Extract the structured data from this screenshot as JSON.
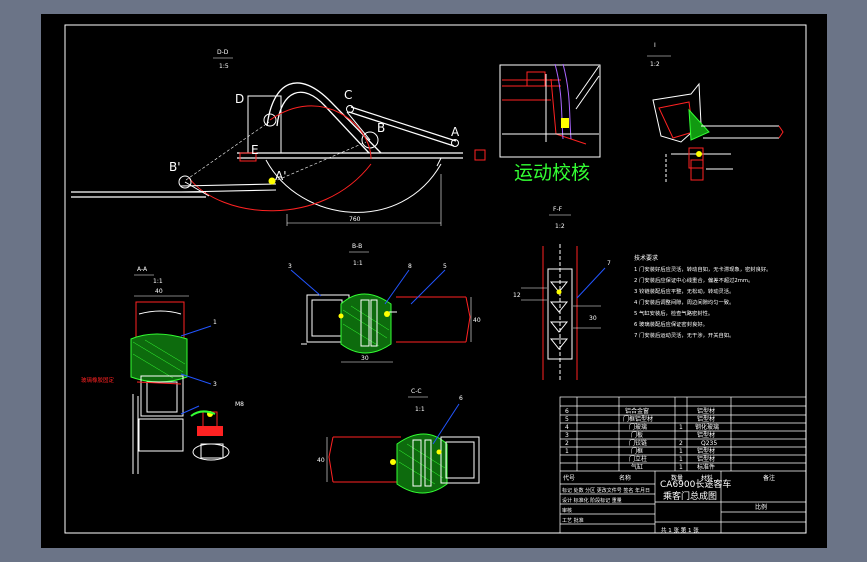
{
  "main_view": {
    "section_label": "D-D",
    "section_scale": "1:5",
    "point_labels": {
      "D": "D",
      "C": "C",
      "B": "B",
      "A": "A",
      "B1": "B'",
      "A1": "A'",
      "E": "E"
    },
    "dimension": "760",
    "motion_check_title": "运动校核"
  },
  "detail_I": {
    "label": "I",
    "scale": "1:2"
  },
  "section_BB": {
    "label": "B-B",
    "scale": "1:1",
    "callouts": [
      "3",
      "8",
      "5"
    ],
    "dim_width": "30",
    "dim_height": "40"
  },
  "section_AA": {
    "label": "A-A",
    "scale": "1:1",
    "dim_width": "40",
    "callouts": [
      "1",
      "3"
    ],
    "note_red": "玻璃橡胶固定",
    "dim_small": "M8"
  },
  "section_CC": {
    "label": "C-C",
    "scale": "1:1",
    "callouts": [
      "6"
    ],
    "dim_height": "40"
  },
  "section_FF": {
    "label": "F-F",
    "scale": "1:2",
    "callouts": [
      "7"
    ],
    "dim_a": "12",
    "dim_b": "30"
  },
  "tech_requirements": {
    "title": "技术要求",
    "items": [
      "1 门安装好后应灵活，转动自如，无卡滞现象，密封良好。",
      "2 门安装后应保证中心线重合，偏差不超过2mm。",
      "3 铰链装配后应平整，无松动，转动灵活。",
      "4 门安装后调整间隙，周边间隙均匀一致。",
      "5 气缸安装后，检查气路密封性。",
      "6 玻璃装配后应保证密封良好。",
      "7 门安装后运动灵活，无干涉，开关自如。"
    ]
  },
  "title_block": {
    "parts": [
      {
        "no": "6",
        "name": "铝合金窗",
        "qty": "",
        "mat": "铝型材",
        "note": ""
      },
      {
        "no": "5",
        "name": "门框铝型材",
        "qty": "",
        "mat": "铝型材",
        "note": ""
      },
      {
        "no": "4",
        "name": "门玻璃",
        "qty": "1",
        "mat": "钢化玻璃",
        "note": ""
      },
      {
        "no": "3",
        "name": "门板",
        "qty": "",
        "mat": "铝型材",
        "note": ""
      },
      {
        "no": "2",
        "name": "门铰链",
        "qty": "2",
        "mat": "Q235",
        "note": ""
      },
      {
        "no": "1",
        "name": "门框",
        "qty": "1",
        "mat": "铝型材",
        "note": ""
      },
      {
        "no": "",
        "name": "门立柱",
        "qty": "1",
        "mat": "铝型材",
        "note": ""
      },
      {
        "no": "",
        "name": "气缸",
        "qty": "1",
        "mat": "标准件",
        "note": ""
      }
    ],
    "headers": {
      "no": "代号",
      "name": "名称",
      "qty": "数量",
      "mat": "材料",
      "note": "备注"
    },
    "project": "CA6900长途客车",
    "drawing_name": "乘客门总成图",
    "scale_label": "比例",
    "sheet": "共 1 张  第 1 张",
    "sign_rows": [
      "标记 处数 分区 更改文件号 签名 年月日",
      "设计 标准化 阶段标记 重量",
      "审核",
      "工艺 批准"
    ]
  },
  "colors": {
    "background": "#000000",
    "frame": "#ffffff",
    "outer": "#6b7487",
    "accent": "#33ff33"
  }
}
